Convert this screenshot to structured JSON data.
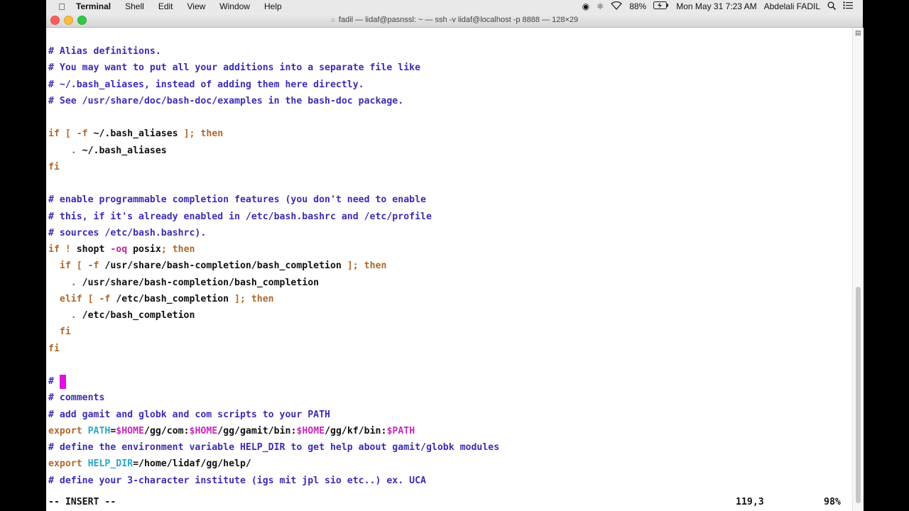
{
  "menubar": {
    "app": "Terminal",
    "items": [
      "Shell",
      "Edit",
      "View",
      "Window",
      "Help"
    ],
    "battery": "88%",
    "clock": "Mon May 31  7:23 AM",
    "user": "Abdelali FADIL"
  },
  "window": {
    "title": "fadil — lidaf@pasnssl: ~ — ssh -v lidaf@localhost -p 8888 — 128×29"
  },
  "editor": {
    "lines": [
      {
        "segs": [
          {
            "t": "# Alias definitions.",
            "c": "comment"
          }
        ]
      },
      {
        "segs": [
          {
            "t": "# You may want to put all your additions into a separate file like",
            "c": "comment"
          }
        ]
      },
      {
        "segs": [
          {
            "t": "# ~/.bash_aliases, instead of adding them here directly.",
            "c": "comment"
          }
        ]
      },
      {
        "segs": [
          {
            "t": "# See /usr/share/doc/bash-doc/examples in the bash-doc package.",
            "c": "comment"
          }
        ]
      },
      {
        "segs": []
      },
      {
        "segs": [
          {
            "t": "if [ -f ",
            "c": "kw"
          },
          {
            "t": "~/.bash_aliases ",
            "c": ""
          },
          {
            "t": "]; then",
            "c": "kw"
          }
        ]
      },
      {
        "segs": [
          {
            "t": "    . ",
            "c": "kw"
          },
          {
            "t": "~/.bash_aliases",
            "c": ""
          }
        ]
      },
      {
        "segs": [
          {
            "t": "fi",
            "c": "kw"
          }
        ]
      },
      {
        "segs": []
      },
      {
        "segs": [
          {
            "t": "# enable programmable completion features (you don't need to enable",
            "c": "comment"
          }
        ]
      },
      {
        "segs": [
          {
            "t": "# this, if it's already enabled in /etc/bash.bashrc and /etc/profile",
            "c": "comment"
          }
        ]
      },
      {
        "segs": [
          {
            "t": "# sources /etc/bash.bashrc).",
            "c": "comment"
          }
        ]
      },
      {
        "segs": [
          {
            "t": "if ! ",
            "c": "kw"
          },
          {
            "t": "shopt ",
            "c": ""
          },
          {
            "t": "-oq ",
            "c": "flag"
          },
          {
            "t": "posix",
            "c": ""
          },
          {
            "t": "; then",
            "c": "kw"
          }
        ]
      },
      {
        "segs": [
          {
            "t": "  if [ -f ",
            "c": "kw"
          },
          {
            "t": "/usr/share/bash-completion/bash_completion ",
            "c": ""
          },
          {
            "t": "]; then",
            "c": "kw"
          }
        ]
      },
      {
        "segs": [
          {
            "t": "    . ",
            "c": "kw"
          },
          {
            "t": "/usr/share/bash-completion/bash_completion",
            "c": ""
          }
        ]
      },
      {
        "segs": [
          {
            "t": "  elif [ -f ",
            "c": "kw"
          },
          {
            "t": "/etc/bash_completion ",
            "c": ""
          },
          {
            "t": "]; then",
            "c": "kw"
          }
        ]
      },
      {
        "segs": [
          {
            "t": "    . ",
            "c": "kw"
          },
          {
            "t": "/etc/bash_completion",
            "c": ""
          }
        ]
      },
      {
        "segs": [
          {
            "t": "  fi",
            "c": "kw"
          }
        ]
      },
      {
        "segs": [
          {
            "t": "fi",
            "c": "kw"
          }
        ]
      },
      {
        "segs": []
      },
      {
        "segs": [
          {
            "t": "# ",
            "c": "comment"
          }
        ],
        "cursor": true
      },
      {
        "segs": [
          {
            "t": "# comments",
            "c": "comment"
          }
        ]
      },
      {
        "segs": [
          {
            "t": "# add gamit and globk and com scripts to your PATH",
            "c": "comment"
          }
        ]
      },
      {
        "segs": [
          {
            "t": "export ",
            "c": "kw"
          },
          {
            "t": "PATH",
            "c": "var"
          },
          {
            "t": "=",
            "c": ""
          },
          {
            "t": "$HOME",
            "c": "env"
          },
          {
            "t": "/gg/com:",
            "c": ""
          },
          {
            "t": "$HOME",
            "c": "env"
          },
          {
            "t": "/gg/gamit/bin:",
            "c": ""
          },
          {
            "t": "$HOME",
            "c": "env"
          },
          {
            "t": "/gg/kf/bin:",
            "c": ""
          },
          {
            "t": "$PATH",
            "c": "env"
          }
        ]
      },
      {
        "segs": [
          {
            "t": "# define the environment variable HELP_DIR to get help about gamit/globk modules",
            "c": "comment"
          }
        ]
      },
      {
        "segs": [
          {
            "t": "export ",
            "c": "kw"
          },
          {
            "t": "HELP_DIR",
            "c": "var"
          },
          {
            "t": "=/home/lidaf/gg/help/",
            "c": ""
          }
        ]
      },
      {
        "segs": [
          {
            "t": "# define your 3-character institute (igs mit jpl sio etc..) ex. UCA",
            "c": "comment"
          }
        ]
      }
    ],
    "status_mode": "-- INSERT --",
    "status_position": "119,3",
    "status_percent": "98%"
  }
}
